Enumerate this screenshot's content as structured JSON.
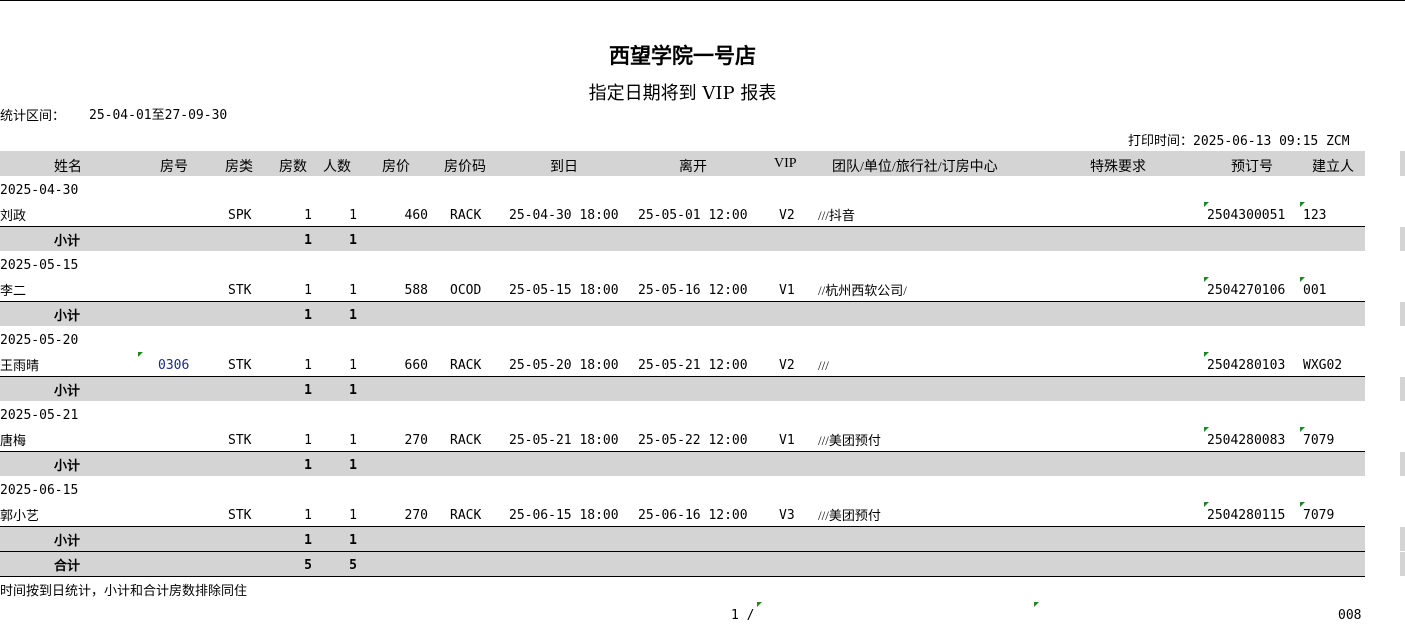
{
  "report": {
    "hotel": "西望学院一号店",
    "title": "指定日期将到 VIP 报表",
    "period_label": "统计区间：",
    "period_value": "25-04-01至27-09-30",
    "print_label": "打印时间：",
    "print_value": "2025-06-13 09:15 ZCM"
  },
  "columns": [
    "姓名",
    "房号",
    "房类",
    "房数",
    "人数",
    "房价",
    "房价码",
    "到日",
    "离开",
    "VIP",
    "团队/单位/旅行社/订房中心",
    "特殊要求",
    "预订号",
    "建立人"
  ],
  "groups": [
    {
      "date": "2025-04-30",
      "guest": {
        "name": "刘政",
        "room": "",
        "type": "SPK",
        "rooms": "1",
        "people": "1",
        "rate": "460",
        "code": "RACK",
        "arrive": "25-04-30 18:00",
        "depart": "25-05-01 12:00",
        "vip": "V2",
        "agency": "///抖音",
        "special": "",
        "booking": "2504300051",
        "creator": "123"
      },
      "subtotal": {
        "label": "小计",
        "rooms": "1",
        "people": "1"
      }
    },
    {
      "date": "2025-05-15",
      "guest": {
        "name": "李二",
        "room": "",
        "type": "STK",
        "rooms": "1",
        "people": "1",
        "rate": "588",
        "code": "OCOD",
        "arrive": "25-05-15 18:00",
        "depart": "25-05-16 12:00",
        "vip": "V1",
        "agency": "//杭州西软公司/",
        "special": "",
        "booking": "2504270106",
        "creator": "001"
      },
      "subtotal": {
        "label": "小计",
        "rooms": "1",
        "people": "1"
      }
    },
    {
      "date": "2025-05-20",
      "guest": {
        "name": "王雨晴",
        "room": "0306",
        "type": "STK",
        "rooms": "1",
        "people": "1",
        "rate": "660",
        "code": "RACK",
        "arrive": "25-05-20 18:00",
        "depart": "25-05-21 12:00",
        "vip": "V2",
        "agency": "///",
        "special": "",
        "booking": "2504280103",
        "creator": "WXG02"
      },
      "subtotal": {
        "label": "小计",
        "rooms": "1",
        "people": "1"
      }
    },
    {
      "date": "2025-05-21",
      "guest": {
        "name": "唐梅",
        "room": "",
        "type": "STK",
        "rooms": "1",
        "people": "1",
        "rate": "270",
        "code": "RACK",
        "arrive": "25-05-21 18:00",
        "depart": "25-05-22 12:00",
        "vip": "V1",
        "agency": "///美团预付",
        "special": "",
        "booking": "2504280083",
        "creator": "7079"
      },
      "subtotal": {
        "label": "小计",
        "rooms": "1",
        "people": "1"
      }
    },
    {
      "date": "2025-06-15",
      "guest": {
        "name": "郭小艺",
        "room": "",
        "type": "STK",
        "rooms": "1",
        "people": "1",
        "rate": "270",
        "code": "RACK",
        "arrive": "25-06-15 18:00",
        "depart": "25-06-16 12:00",
        "vip": "V3",
        "agency": "///美团预付",
        "special": "",
        "booking": "2504280115",
        "creator": "7079"
      },
      "subtotal": {
        "label": "小计",
        "rooms": "1",
        "people": "1"
      }
    }
  ],
  "total": {
    "label": "合计",
    "rooms": "5",
    "people": "5"
  },
  "footer": {
    "note": "时间按到日统计，小计和合计房数排除同住",
    "page": "1 /",
    "code": "008"
  },
  "colors": {
    "band": "#d4d4d4",
    "marker": "#1a8a1a",
    "link": "#1a2a8a"
  }
}
